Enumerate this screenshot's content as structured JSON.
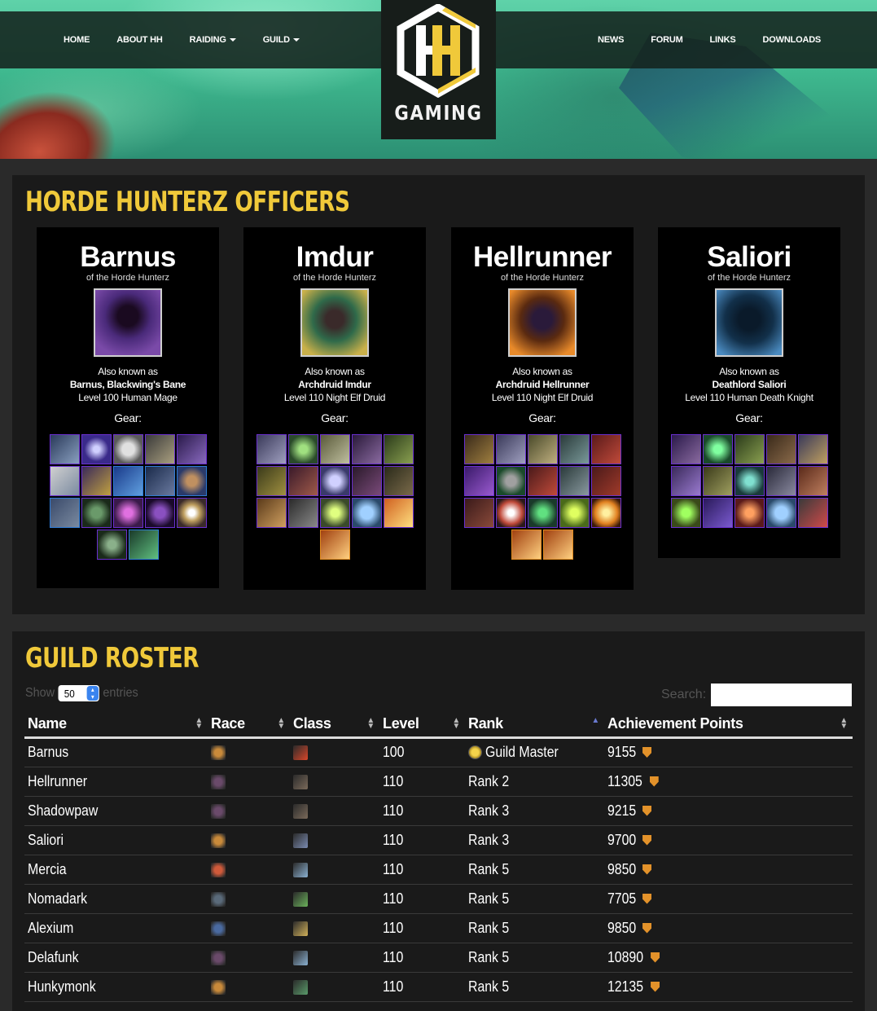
{
  "nav": {
    "left": [
      {
        "label": "HOME",
        "dropdown": false
      },
      {
        "label": "ABOUT HH",
        "dropdown": false
      },
      {
        "label": "RAIDING",
        "dropdown": true
      },
      {
        "label": "GUILD",
        "dropdown": true
      }
    ],
    "right": [
      {
        "label": "NEWS"
      },
      {
        "label": "FORUM"
      },
      {
        "label": "LINKS"
      },
      {
        "label": "DOWNLOADS"
      }
    ]
  },
  "logo": {
    "text": "GAMING",
    "accent": "#f0c93a"
  },
  "officers": {
    "title": "HORDE HUNTERZ OFFICERS",
    "cards": [
      {
        "name": "Barnus",
        "sub": "of the Horde Hunterz",
        "aka_label": "Also known as",
        "aka_title": "Barnus, Blackwing's Bane",
        "desc": "Level 100 Human Mage",
        "gear_label": "Gear:",
        "portrait_colors": [
          "#4a2a7a",
          "#7a4aa8"
        ]
      },
      {
        "name": "Imdur",
        "sub": "of the Horde Hunterz",
        "aka_label": "Also known as",
        "aka_title": "Archdruid Imdur",
        "desc": "Level 110 Night Elf Druid",
        "gear_label": "Gear:",
        "portrait_colors": [
          "#2f6a4a",
          "#c9b04a"
        ]
      },
      {
        "name": "Hellrunner",
        "sub": "of the Horde Hunterz",
        "aka_label": "Also known as",
        "aka_title": "Archdruid Hellrunner",
        "desc": "Level 110 Night Elf Druid",
        "gear_label": "Gear:",
        "portrait_colors": [
          "#5a2a10",
          "#e88a2a"
        ]
      },
      {
        "name": "Saliori",
        "sub": "of the Horde Hunterz",
        "aka_label": "Also known as",
        "aka_title": "Deathlord Saliori",
        "desc": "Level 110 Human Death Knight",
        "gear_label": "Gear:",
        "portrait_colors": [
          "#12304a",
          "#4a8ac0"
        ]
      }
    ]
  },
  "roster": {
    "title": "GUILD ROSTER",
    "show_label": "Show",
    "entries_value": "50",
    "entries_label": "entries",
    "search_label": "Search:",
    "columns": [
      "Name",
      "Race",
      "Class",
      "Level",
      "Rank",
      "Achievement Points"
    ],
    "rows": [
      {
        "name": "Barnus",
        "level": "100",
        "rank": "Guild Master",
        "points": "9155",
        "race_color": "#c98a3a",
        "class_color": "#d8462a",
        "gm": true
      },
      {
        "name": "Hellrunner",
        "level": "110",
        "rank": "Rank 2",
        "points": "11305",
        "race_color": "#6a4a6a",
        "class_color": "#7a6a5a",
        "gm": false
      },
      {
        "name": "Shadowpaw",
        "level": "110",
        "rank": "Rank 3",
        "points": "9215",
        "race_color": "#6a4a6a",
        "class_color": "#7a6a5a",
        "gm": false
      },
      {
        "name": "Saliori",
        "level": "110",
        "rank": "Rank 3",
        "points": "9700",
        "race_color": "#c98a3a",
        "class_color": "#7a8ab0",
        "gm": false
      },
      {
        "name": "Mercia",
        "level": "110",
        "rank": "Rank 5",
        "points": "9850",
        "race_color": "#d05a3a",
        "class_color": "#8ab0d0",
        "gm": false
      },
      {
        "name": "Nomadark",
        "level": "110",
        "rank": "Rank 5",
        "points": "7705",
        "race_color": "#5a6a7a",
        "class_color": "#6ab05a",
        "gm": false
      },
      {
        "name": "Alexium",
        "level": "110",
        "rank": "Rank 5",
        "points": "9850",
        "race_color": "#4a6aa0",
        "class_color": "#d0b05a",
        "gm": false
      },
      {
        "name": "Delafunk",
        "level": "110",
        "rank": "Rank 5",
        "points": "10890",
        "race_color": "#6a4a6a",
        "class_color": "#8ab0d0",
        "gm": false
      },
      {
        "name": "Hunkymonk",
        "level": "110",
        "rank": "Rank 5",
        "points": "12135",
        "race_color": "#c98a3a",
        "class_color": "#5a9a6a",
        "gm": false
      }
    ]
  }
}
